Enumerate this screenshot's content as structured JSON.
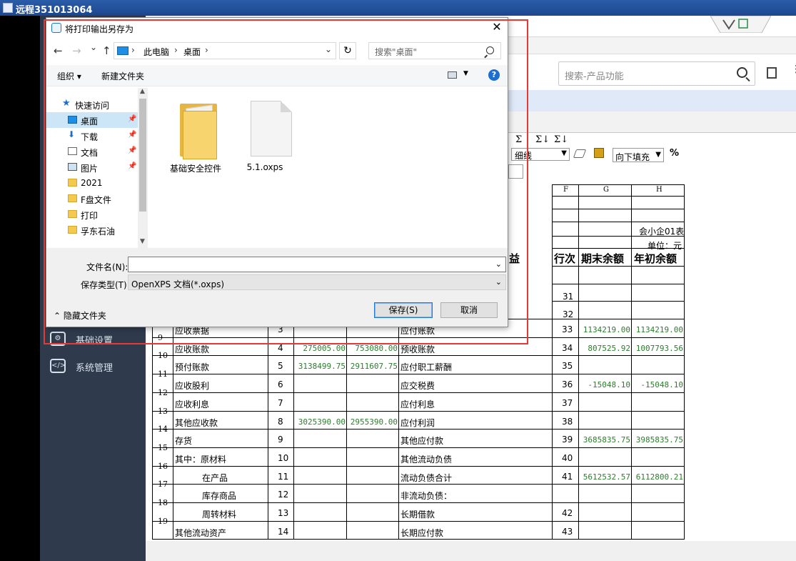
{
  "remote_window": {
    "title": "远程351013064"
  },
  "sidebar": {
    "items": [
      {
        "label": "基础设置",
        "icon": "gear-icon"
      },
      {
        "label": "系统管理",
        "icon": "monitor-code-icon"
      }
    ]
  },
  "app": {
    "search_placeholder": "搜索-产品功能",
    "toolbar": {
      "sigma_labels": [
        "Σ",
        "Σ↓",
        "Σ↓"
      ],
      "line_style": "细线",
      "fill_direction": "向下填充",
      "percent": "%",
      "comma": ","
    }
  },
  "sheet": {
    "column_headers": [
      "F",
      "G",
      "H"
    ],
    "form_code": "会小企01表",
    "unit": "单位：元",
    "headers": {
      "liab_label": "益",
      "line_no": "行次",
      "end_balance": "期末余额",
      "begin_balance": "年初余额"
    },
    "top_rows": [
      {
        "line": "31"
      },
      {
        "line": "32"
      }
    ],
    "rows": [
      {
        "row": "8",
        "asset": "应收票据",
        "asset_line": "3",
        "asset_end": "",
        "asset_begin": "",
        "liab": "应付账款",
        "liab_line": "33",
        "liab_end": "1134219.00",
        "liab_begin": "1134219.00"
      },
      {
        "row": "9",
        "asset": "应收账款",
        "asset_line": "4",
        "asset_end": "275005.00",
        "asset_begin": "753080.00",
        "liab": "预收账款",
        "liab_line": "34",
        "liab_end": "807525.92",
        "liab_begin": "1007793.56"
      },
      {
        "row": "10",
        "asset": "预付账款",
        "asset_line": "5",
        "asset_end": "3138499.75",
        "asset_begin": "2911607.75",
        "liab": "应付职工薪酬",
        "liab_line": "35",
        "liab_end": "",
        "liab_begin": ""
      },
      {
        "row": "11",
        "asset": "应收股利",
        "asset_line": "6",
        "asset_end": "",
        "asset_begin": "",
        "liab": "应交税费",
        "liab_line": "36",
        "liab_end": "-15048.10",
        "liab_begin": "-15048.10"
      },
      {
        "row": "12",
        "asset": "应收利息",
        "asset_line": "7",
        "asset_end": "",
        "asset_begin": "",
        "liab": "应付利息",
        "liab_line": "37",
        "liab_end": "",
        "liab_begin": ""
      },
      {
        "row": "13",
        "asset": "其他应收款",
        "asset_line": "8",
        "asset_end": "3025390.00",
        "asset_begin": "2955390.00",
        "liab": "应付利润",
        "liab_line": "38",
        "liab_end": "",
        "liab_begin": ""
      },
      {
        "row": "14",
        "asset": "存货",
        "asset_line": "9",
        "asset_end": "",
        "asset_begin": "",
        "liab": "其他应付款",
        "liab_line": "39",
        "liab_end": "3685835.75",
        "liab_begin": "3985835.75"
      },
      {
        "row": "15",
        "asset": "其中：原材料",
        "asset_line": "10",
        "asset_end": "",
        "asset_begin": "",
        "liab": "其他流动负债",
        "liab_line": "40",
        "liab_end": "",
        "liab_begin": ""
      },
      {
        "row": "16",
        "asset": "在产品",
        "asset_line": "11",
        "asset_end": "",
        "asset_begin": "",
        "liab": "流动负债合计",
        "liab_line": "41",
        "liab_end": "5612532.57",
        "liab_begin": "6112800.21"
      },
      {
        "row": "17",
        "asset": "库存商品",
        "asset_line": "12",
        "asset_end": "",
        "asset_begin": "",
        "liab": "非流动负债：",
        "liab_line": "",
        "liab_end": "",
        "liab_begin": ""
      },
      {
        "row": "18",
        "asset": "周转材料",
        "asset_line": "13",
        "asset_end": "",
        "asset_begin": "",
        "liab": "长期借款",
        "liab_line": "42",
        "liab_end": "",
        "liab_begin": ""
      },
      {
        "row": "19",
        "asset": "其他流动资产",
        "asset_line": "14",
        "asset_end": "",
        "asset_begin": "",
        "liab": "长期应付款",
        "liab_line": "43",
        "liab_end": "",
        "liab_begin": ""
      }
    ]
  },
  "dialog": {
    "title": "将打印输出另存为",
    "close": "✕",
    "nav": {
      "back": "←",
      "forward": "→",
      "recent": "⌄",
      "up": "↑",
      "refresh": "↻"
    },
    "breadcrumb": [
      "此电脑",
      "桌面"
    ],
    "search_placeholder": "搜索\"桌面\"",
    "organize": "组织 ▾",
    "new_folder": "新建文件夹",
    "help": "?",
    "nav_pane": {
      "quick_access": "快速访问",
      "items": [
        {
          "label": "桌面",
          "pinned": true,
          "selected": true
        },
        {
          "label": "下载",
          "pinned": true
        },
        {
          "label": "文档",
          "pinned": true
        },
        {
          "label": "图片",
          "pinned": true
        },
        {
          "label": "2021"
        },
        {
          "label": "F盘文件"
        },
        {
          "label": "打印"
        },
        {
          "label": "孚东石油"
        }
      ]
    },
    "files": [
      {
        "name": "基础安全控件",
        "type": "folder"
      },
      {
        "name": "5.1.oxps",
        "type": "document"
      }
    ],
    "filename_label": "文件名(N):",
    "filename_value": "",
    "filetype_label": "保存类型(T):",
    "filetype_value": "OpenXPS 文档(*.oxps)",
    "hide_folders": "隐藏文件夹",
    "save_label": "保存(S)",
    "cancel_label": "取消"
  },
  "colors": {
    "accent": "#1c6fd1",
    "highlight_box": "#e53935",
    "sidebar": "#2f3b4d",
    "number_green": "#2d7d2d"
  }
}
